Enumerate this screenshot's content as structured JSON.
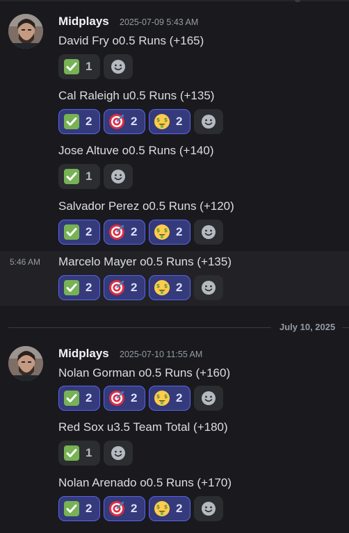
{
  "groups": [
    {
      "author": "Midplays",
      "timestamp": "2025-07-09 5:43 AM",
      "messages": [
        {
          "text": "David Fry o0.5 Runs (+165)",
          "reactions": [
            {
              "emoji": "check-mark-emoji",
              "count": "1",
              "active": false
            }
          ]
        },
        {
          "text": "Cal Raleigh u0.5 Runs (+135)",
          "reactions": [
            {
              "emoji": "check-mark-emoji",
              "count": "2",
              "active": true
            },
            {
              "emoji": "target-emoji",
              "count": "2",
              "active": true
            },
            {
              "emoji": "money-face-emoji",
              "count": "2",
              "active": true
            }
          ]
        },
        {
          "text": "Jose Altuve o0.5 Runs (+140)",
          "reactions": [
            {
              "emoji": "check-mark-emoji",
              "count": "1",
              "active": false
            }
          ]
        },
        {
          "text": "Salvador Perez o0.5 Runs (+120)",
          "reactions": [
            {
              "emoji": "check-mark-emoji",
              "count": "2",
              "active": true
            },
            {
              "emoji": "target-emoji",
              "count": "2",
              "active": true
            },
            {
              "emoji": "money-face-emoji",
              "count": "2",
              "active": true
            }
          ]
        },
        {
          "text": "Marcelo Mayer o0.5 Runs (+135)",
          "hover_time": "5:46 AM",
          "reactions": [
            {
              "emoji": "check-mark-emoji",
              "count": "2",
              "active": true
            },
            {
              "emoji": "target-emoji",
              "count": "2",
              "active": true
            },
            {
              "emoji": "money-face-emoji",
              "count": "2",
              "active": true
            }
          ]
        }
      ]
    },
    {
      "author": "Midplays",
      "timestamp": "2025-07-10 11:55 AM",
      "messages": [
        {
          "text": "Nolan Gorman o0.5 Runs (+160)",
          "reactions": [
            {
              "emoji": "check-mark-emoji",
              "count": "2",
              "active": true
            },
            {
              "emoji": "target-emoji",
              "count": "2",
              "active": true
            },
            {
              "emoji": "money-face-emoji",
              "count": "2",
              "active": true
            }
          ]
        },
        {
          "text": "Red Sox u3.5 Team Total (+180)",
          "reactions": [
            {
              "emoji": "check-mark-emoji",
              "count": "1",
              "active": false
            }
          ]
        },
        {
          "text": "Nolan Arenado o0.5 Runs (+170)",
          "reactions": [
            {
              "emoji": "check-mark-emoji",
              "count": "2",
              "active": true
            },
            {
              "emoji": "target-emoji",
              "count": "2",
              "active": true
            },
            {
              "emoji": "money-face-emoji",
              "count": "2",
              "active": true
            }
          ]
        }
      ]
    }
  ],
  "date_divider": "July 10, 2025",
  "colors": {
    "background": "#1a1a1e",
    "reaction_active_bg": "#353a7a",
    "reaction_active_border": "#5865f2",
    "reaction_bg": "#2b2d31"
  }
}
